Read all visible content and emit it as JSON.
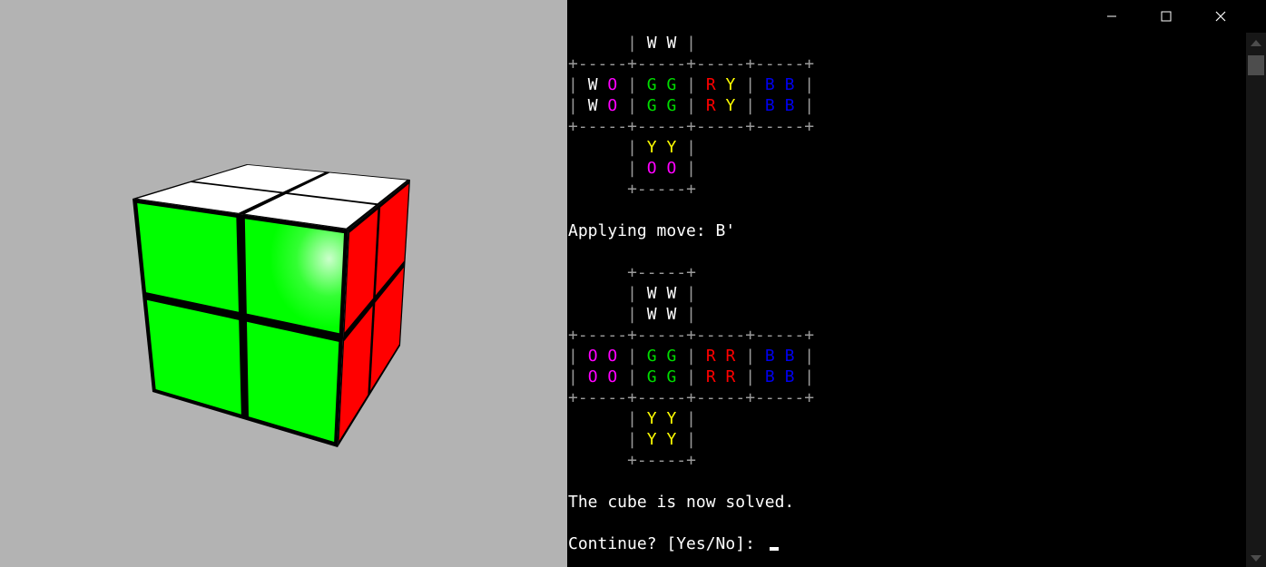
{
  "window": {
    "minimize_glyph": "—",
    "maximize_glyph": "☐",
    "close_glyph": "✕"
  },
  "cube": {
    "top_face": [
      "W",
      "W",
      "W",
      "W"
    ],
    "front_face": [
      "G",
      "G",
      "G",
      "G"
    ],
    "right_face": [
      "R",
      "R",
      "R",
      "R"
    ],
    "colors": {
      "W": "#ffffff",
      "G": "#00ff00",
      "R": "#ff0000",
      "O": "#ff00ff",
      "Y": "#ffff00",
      "B": "#0000ee",
      "border": "#000000",
      "background": "#b3b3b3"
    }
  },
  "terminal": {
    "lines": [
      "      | W W |",
      "+-----+-----+-----+-----+",
      "| W O | G G | R Y | B B |",
      "| W O | G G | R Y | B B |",
      "+-----+-----+-----+-----+",
      "      | Y Y |",
      "      | O O |",
      "      +-----+",
      "",
      "Applying move: B'",
      "",
      "      +-----+",
      "      | W W |",
      "      | W W |",
      "+-----+-----+-----+-----+",
      "| O O | G G | R R | B B |",
      "| O O | G G | R R | B B |",
      "+-----+-----+-----+-----+",
      "      | Y Y |",
      "      | Y Y |",
      "      +-----+",
      "",
      "The cube is now solved.",
      "",
      "Continue? [Yes/No]: "
    ],
    "colored_rows": [
      0,
      2,
      3,
      5,
      6,
      12,
      13,
      15,
      16,
      18,
      19
    ],
    "prompt_row": 24
  }
}
